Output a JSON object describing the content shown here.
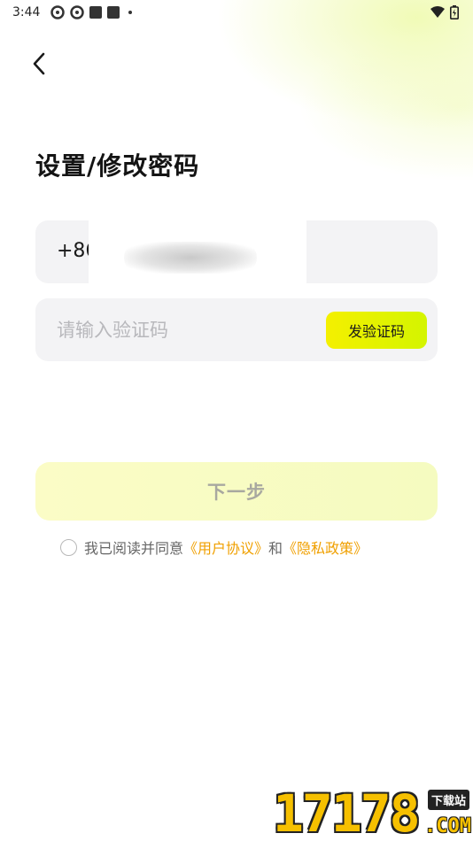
{
  "status_bar": {
    "time": "3:44"
  },
  "page": {
    "title": "设置/修改密码"
  },
  "phone_field": {
    "prefix": "+86"
  },
  "code_field": {
    "placeholder": "请输入验证码",
    "send_button_label": "发验证码"
  },
  "next_button_label": "下一步",
  "agreement": {
    "text": "我已阅读并同意",
    "user_agreement_link": "《用户协议》",
    "conjunction": "和",
    "privacy_policy_link": "《隐私政策》"
  },
  "watermark": {
    "digits": "17178",
    "badge": "下载站",
    "domain": ".COM"
  },
  "colors": {
    "accent": "#f0a000",
    "button_yellow": "#e8f200",
    "field_bg": "#f3f3f5"
  },
  "icons": [
    "back-chevron-icon",
    "wifi-icon",
    "battery-icon",
    "app-notification-icon"
  ]
}
